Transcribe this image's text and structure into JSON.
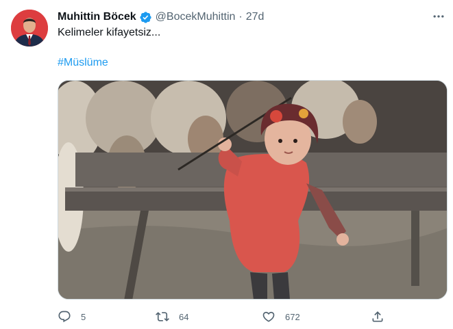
{
  "user": {
    "display_name": "Muhittin Böcek",
    "handle": "@BocekMuhittin",
    "separator": "·",
    "time": "27d"
  },
  "tweet": {
    "text": "Kelimeler kifayetsiz...",
    "hashtag": "#Müslüme"
  },
  "actions": {
    "reply_count": "5",
    "retweet_count": "64",
    "like_count": "672"
  },
  "icons": {
    "verified": "verified-badge-icon",
    "more": "more-horizontal-icon",
    "reply": "reply-icon",
    "retweet": "retweet-icon",
    "like": "heart-icon",
    "share": "share-icon"
  },
  "colors": {
    "accent": "#1d9bf0",
    "secondary_text": "#536471",
    "primary_text": "#0f1419"
  }
}
